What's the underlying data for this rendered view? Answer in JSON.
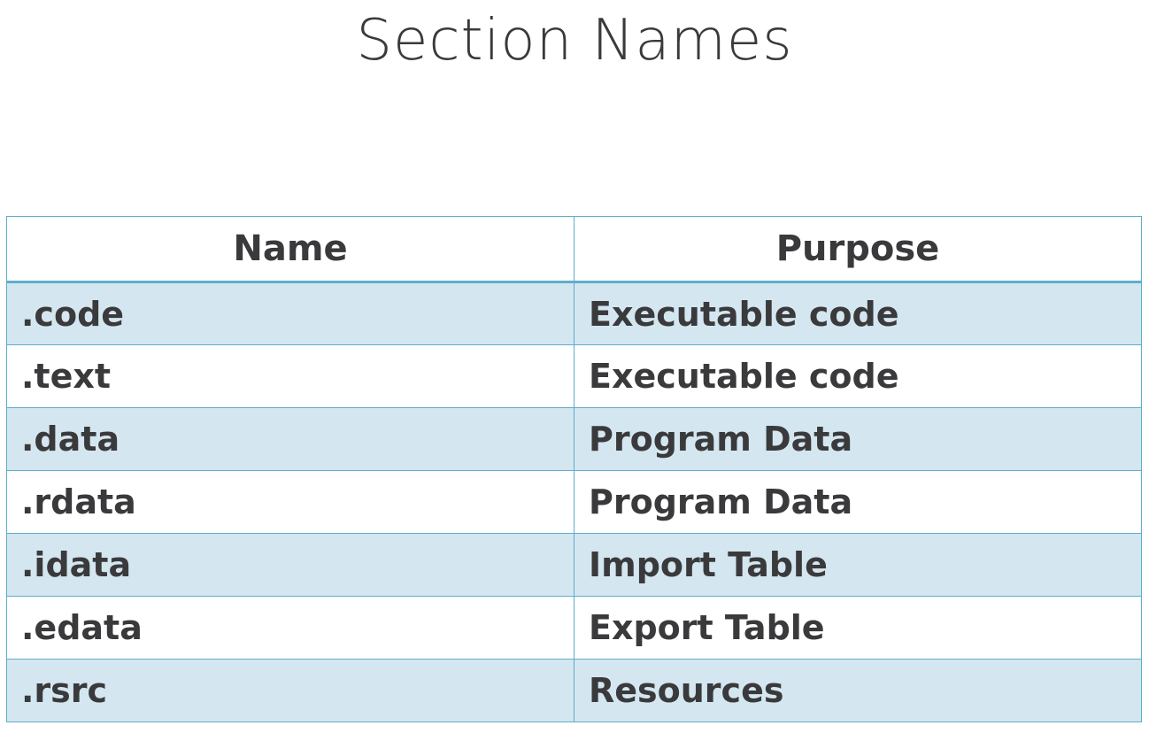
{
  "title": "Section Names",
  "table": {
    "headers": [
      "Name",
      "Purpose"
    ],
    "rows": [
      {
        "name": ".code",
        "purpose": "Executable code"
      },
      {
        "name": ".text",
        "purpose": "Executable code"
      },
      {
        "name": ".data",
        "purpose": "Program Data"
      },
      {
        "name": ".rdata",
        "purpose": "Program Data"
      },
      {
        "name": ".idata",
        "purpose": "Import Table"
      },
      {
        "name": ".edata",
        "purpose": "Export Table"
      },
      {
        "name": ".rsrc",
        "purpose": "Resources"
      }
    ]
  },
  "colors": {
    "border": "#5eaec9",
    "shaded_row": "#d4e6f0",
    "text": "#3a3a3c"
  }
}
